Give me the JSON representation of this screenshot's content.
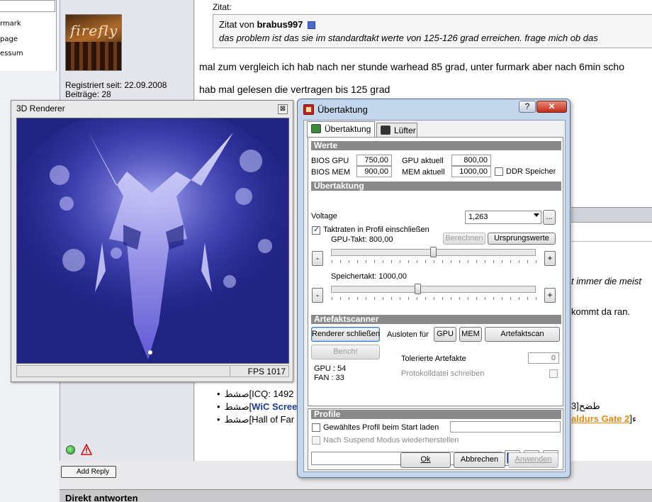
{
  "forum": {
    "nav_items": [
      "rmark",
      "page",
      "essum"
    ],
    "zitat_label": "Zitat:",
    "quote_prefix": "Zitat von",
    "quote_author": "brabus997",
    "quote_text": "das problem ist das sie im standardtakt werte von 125-126 grad erreichen. frage mich ob das",
    "reg_date": "Registriert seit: 22.09.2008",
    "posts": "Beiträge: 28",
    "line1": "mal zum vergleich ich hab nach ner stunde warhead 85 grad, unter furmark aber nach 6min scho",
    "line2": "hab mal gelesen die vertragen bis 125 grad",
    "line3": "t immer die meist",
    "line4": "kommt da ran.",
    "sig1": "صشط[ICQ: 1492",
    "sig2_prefix": "صشط[",
    "sig2_link": "WiC Scree",
    "sig2_right": "3]طضح",
    "sig3": "صشط[Hall of Far",
    "sig3_link": "aldurs Gate 2",
    "sig3_end": "]ء",
    "add_reply": "Add Reply",
    "direkt": "Direkt antworten",
    "avatar_logo": "firefly"
  },
  "renderer": {
    "title": "3D Renderer",
    "close_symbol": "⊠",
    "fps": "FPS 1017"
  },
  "dialog": {
    "title": "Übertaktung",
    "help": "?",
    "close": "✕",
    "tabs": {
      "oc": "Übertaktung",
      "fan": "Lüfter"
    },
    "werte": {
      "header": "Werte",
      "bios_gpu_label": "BIOS GPU",
      "bios_gpu": "750,00",
      "gpu_current_label": "GPU aktuell",
      "gpu_current": "800,00",
      "bios_mem_label": "BIOS MEM",
      "bios_mem": "900,00",
      "mem_current_label": "MEM aktuell",
      "mem_current": "1000,00",
      "ddr_label": "DDR Speicher"
    },
    "oc": {
      "header": "Übertaktung",
      "voltage_label": "Voltage",
      "voltage_value": "1,263",
      "more_button": "...",
      "include_clocks": "Taktraten in Profil einschließen",
      "calc_button": "Berechnen",
      "reset_button": "Ursprungswerte",
      "gpu_clock": "GPU-Takt: 800,00",
      "mem_clock": "Speichertakt: 1000,00",
      "minus": "-",
      "plus": "+",
      "gpu_clock_fraction": 0.5,
      "mem_clock_fraction": 0.42
    },
    "artifacts": {
      "header": "Artefaktscanner",
      "close_renderer": "Renderer schließen",
      "test_for": "Ausloten für",
      "gpu_btn": "GPU",
      "mem_btn": "MEM",
      "scan_btn": "Artefaktscan",
      "bench_btn": "Bench!",
      "tolerated": "Tolerierte Artefakte",
      "tolerated_value": "0",
      "gpu_temp": "GPU : 54",
      "fan": "FAN : 33",
      "log_label": "Protokolldatei schreiben"
    },
    "profile": {
      "header": "Profile",
      "load_on_start": "Gewähltes Profil beim Start laden",
      "restore_suspend": "Nach Suspend Modus wiederherstellen"
    },
    "buttons": {
      "ok": "Ok",
      "cancel": "Abbrechen",
      "apply": "Anwenden"
    }
  }
}
